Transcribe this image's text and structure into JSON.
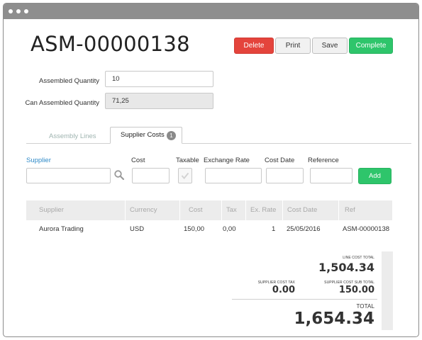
{
  "window": {
    "dots": [
      "",
      "",
      ""
    ]
  },
  "title": "ASM-00000138",
  "actions": {
    "delete": "Delete",
    "print": "Print",
    "save": "Save",
    "complete": "Complete"
  },
  "fields": {
    "assembled_qty": {
      "label": "Assembled Quantity",
      "value": "10"
    },
    "can_assembled_qty": {
      "label": "Can Assembled Quantity",
      "value": "71,25"
    }
  },
  "tabs": {
    "assembly_lines": "Assembly Lines",
    "supplier_costs": "Supplier Costs",
    "supplier_costs_count": "1"
  },
  "form": {
    "supplier": "Supplier",
    "cost": "Cost",
    "taxable": "Taxable",
    "exchange_rate": "Exchange Rate",
    "cost_date": "Cost Date",
    "reference": "Reference",
    "add": "Add"
  },
  "table": {
    "headers": [
      "Supplier",
      "Currency",
      "Cost",
      "Tax",
      "Ex. Rate",
      "Cost Date",
      "Ref"
    ],
    "rows": [
      [
        "Aurora Trading",
        "USD",
        "150,00",
        "0,00",
        "1",
        "25/05/2016",
        "ASM-00000138"
      ]
    ]
  },
  "totals": {
    "line_cost_total_label": "LINE COST TOTAL",
    "line_cost_total": "1,504.34",
    "supplier_cost_tax_label": "SUPPLIER COST TAX",
    "supplier_cost_tax": "0.00",
    "supplier_cost_sub_total_label": "SUPPLIER COST SUB TOTAL",
    "supplier_cost_sub_total": "150.00",
    "total_label": "TOTAL",
    "total": "1,654.34"
  },
  "colors": {
    "danger": "#e4443c",
    "success": "#2ec56b",
    "link": "#2f8ac8"
  },
  "icons": [
    "search-icon",
    "check-icon"
  ]
}
